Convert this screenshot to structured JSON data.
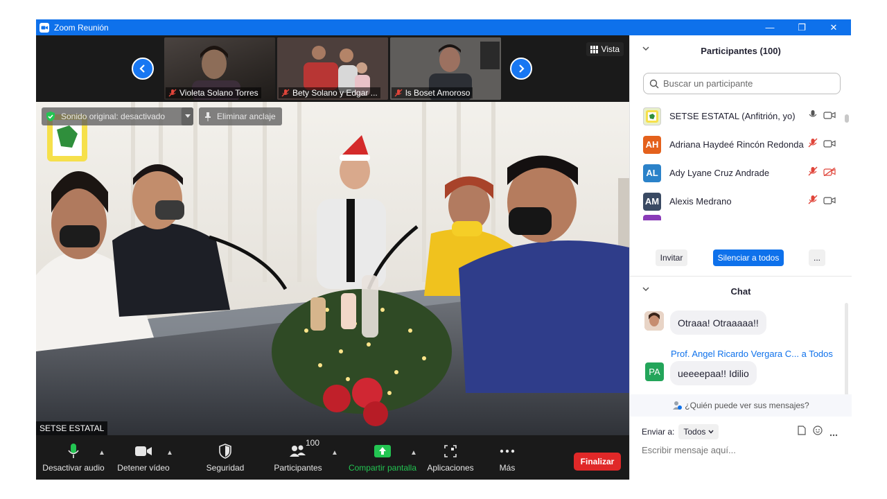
{
  "window": {
    "title": "Zoom Reunión",
    "minimize": "—",
    "restore": "❐",
    "close": "✕"
  },
  "gallery": {
    "thumbs": [
      {
        "name": "Violeta Solano Torres"
      },
      {
        "name": "Bety Solano y Edgar ..."
      },
      {
        "name": "ls Boset Amoroso"
      }
    ],
    "view_label": "Vista"
  },
  "main": {
    "original_sound": "Sonido original: desactivado",
    "unpin": "Eliminar anclaje",
    "speaker": "SETSE ESTATAL"
  },
  "toolbar": {
    "mute": "Desactivar audio",
    "video": "Detener vídeo",
    "security": "Seguridad",
    "participants": "Participantes",
    "participants_count": "100",
    "share": "Compartir pantalla",
    "apps": "Aplicaciones",
    "more": "Más",
    "end": "Finalizar"
  },
  "participants": {
    "header": "Participantes (100)",
    "search_placeholder": "Buscar un participante",
    "list": [
      {
        "initials": "",
        "name": "SETSE ESTATAL (Anfitrión, yo)",
        "color": "#e8f0c8"
      },
      {
        "initials": "AH",
        "name": "Adriana Haydeé Rincón Redonda",
        "color": "#e4611c"
      },
      {
        "initials": "AL",
        "name": "Ady Lyane Cruz Andrade",
        "color": "#2b82c9"
      },
      {
        "initials": "AM",
        "name": "Alexis Medrano",
        "color": "#3a4a63"
      }
    ],
    "invite": "Invitar",
    "mute_all": "Silenciar a todos",
    "more": "..."
  },
  "chat": {
    "header": "Chat",
    "messages": [
      {
        "sender": "",
        "text": "Otraaa! Otraaaaa!!"
      },
      {
        "sender": "Prof. Angel Ricardo Vergara C... a Todos",
        "initials": "PA",
        "text": "ueeeepaa!! Idilio"
      }
    ],
    "who_can_see": "¿Quién puede ver sus mensajes?",
    "send_to_label": "Enviar a:",
    "send_to_value": "Todos",
    "compose_placeholder": "Escribir mensaje aquí..."
  },
  "colors": {
    "accent": "#0e71eb",
    "end": "#e02828",
    "share": "#23c552",
    "muted": "#e0453a"
  }
}
